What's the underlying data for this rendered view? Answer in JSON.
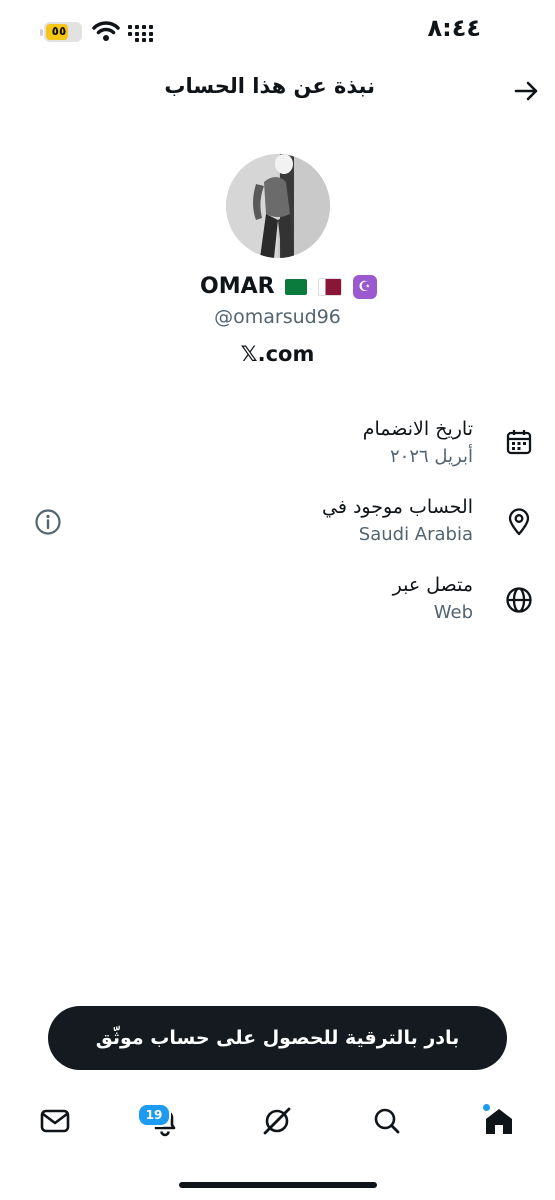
{
  "status_bar": {
    "time": "٨:٤٤",
    "battery_label": "٥٥"
  },
  "header": {
    "title": "نبذة عن هذا الحساب",
    "back_icon": "arrow-right-icon"
  },
  "profile": {
    "display_name": "OMAR",
    "flags": [
      "flag-saudi-arabia",
      "flag-qatar",
      "star-and-crescent"
    ],
    "handle": "@omarsud96",
    "domain": "𝕏.com"
  },
  "info_rows": [
    {
      "icon": "calendar-icon",
      "title": "تاريخ الانضمام",
      "value": "أبريل ٢٠٢٦"
    },
    {
      "icon": "location-pin-icon",
      "title": "الحساب موجود في",
      "value": "Saudi Arabia"
    },
    {
      "icon": "globe-icon",
      "title": "متصل عبر",
      "value": "Web"
    }
  ],
  "upgrade_banner": {
    "label": "بادر بالترقية للحصول على حساب موثّق"
  },
  "bottom_nav": {
    "items": [
      "mail-icon",
      "bell-icon",
      "grok-icon",
      "search-icon",
      "home-icon"
    ],
    "notifications_count": "19"
  },
  "colors": {
    "accent": "#1d9bf0",
    "text_primary": "#0f1419",
    "text_secondary": "#536471",
    "banner_bg": "#141a1f"
  }
}
